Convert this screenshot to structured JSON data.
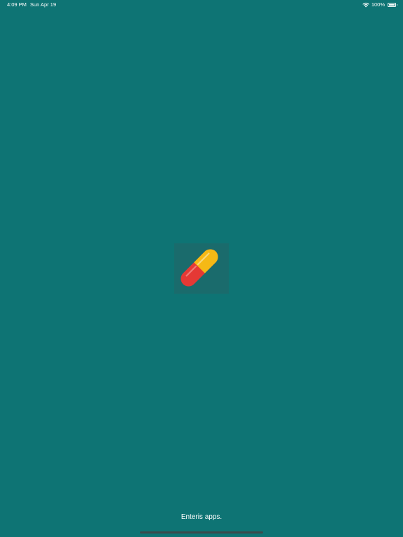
{
  "status_bar": {
    "time": "4:09 PM",
    "date": "Sun Apr 19",
    "battery_percent": "100%",
    "wifi_icon": "wifi-icon",
    "battery_icon": "battery-full-icon"
  },
  "splash": {
    "logo_icon": "pill-capsule-icon",
    "footer": "Enteris apps."
  },
  "colors": {
    "background": "#0e7474",
    "logo_tile": "#1a6b6c",
    "capsule_red": "#e53935",
    "capsule_yellow": "#f5b915",
    "home_indicator": "#3b4b4c"
  }
}
